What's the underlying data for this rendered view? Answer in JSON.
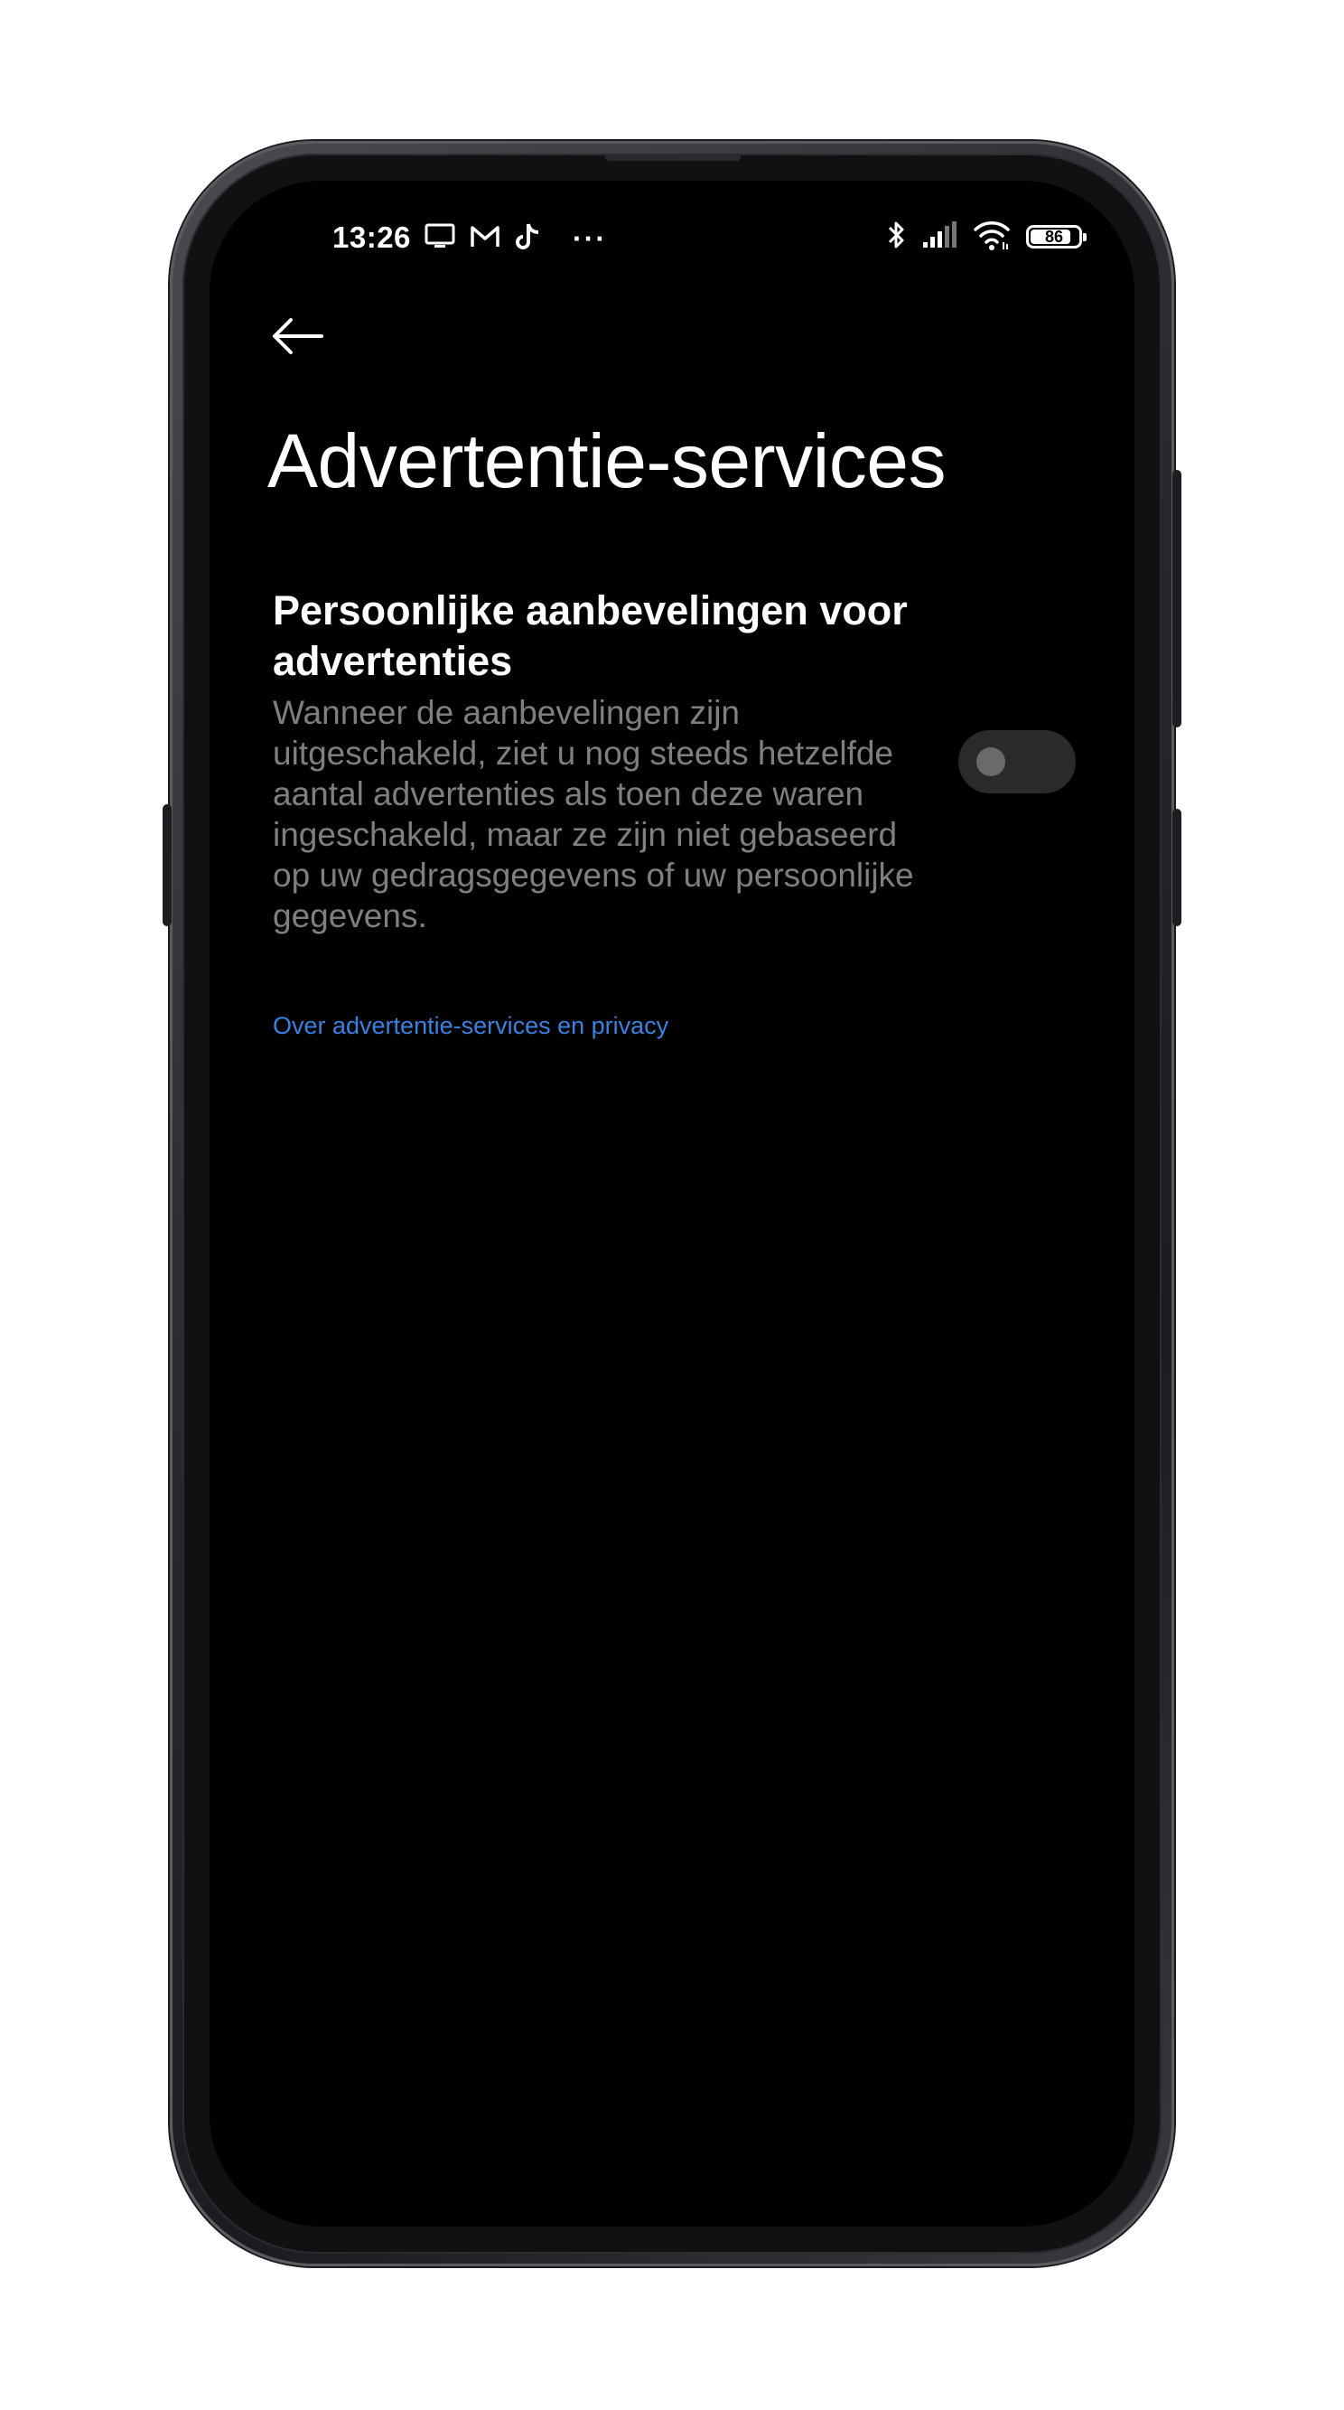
{
  "status_bar": {
    "time": "13:26",
    "overflow": "···",
    "battery_level": "86",
    "left_icons": [
      "screen-cast-icon",
      "gmail-icon",
      "tiktok-icon"
    ],
    "right_icons": [
      "bluetooth-icon",
      "cellular-signal-icon",
      "wifi-icon",
      "battery-icon"
    ]
  },
  "header": {
    "back_icon": "arrow-left-icon",
    "title": "Advertentie-services"
  },
  "setting": {
    "title": "Persoonlijke aanbevelingen voor advertenties",
    "description": "Wanneer de aanbevelingen zijn uitgeschakeld, ziet u nog steeds hetzelfde aantal advertenties als toen deze waren ingeschakeld, maar ze zijn niet gebaseerd op uw gedragsgegevens of uw persoonlijke gegevens.",
    "toggle_on": false
  },
  "link": {
    "label": "Over advertentie-services en privacy"
  },
  "colors": {
    "background": "#000000",
    "text_primary": "#ffffff",
    "text_secondary": "#7f7f7f",
    "link": "#3b82e0",
    "toggle_track_off": "#2a2a2a",
    "toggle_knob_off": "#6a6a6a"
  }
}
